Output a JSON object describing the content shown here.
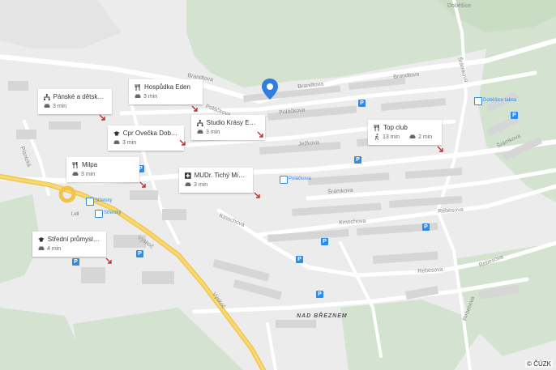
{
  "map": {
    "copyright": "© ČÚZK",
    "streets": [
      {
        "id": "brandtova-1",
        "text": "Brandtova"
      },
      {
        "id": "brandtova-2",
        "text": "Brandtova"
      },
      {
        "id": "brandtova-3",
        "text": "Brandtova"
      },
      {
        "id": "polackova-1",
        "text": "Poláčkova"
      },
      {
        "id": "polackova-2",
        "text": "Poláčkova"
      },
      {
        "id": "jezkova",
        "text": "Ježkova"
      },
      {
        "id": "sramkova-1",
        "text": "Šrámkova"
      },
      {
        "id": "sramkova-2",
        "text": "Šrámkova"
      },
      {
        "id": "sramkova-3",
        "text": "Šrámkova"
      },
      {
        "id": "kmochova-1",
        "text": "Kmochova"
      },
      {
        "id": "kmochova-2",
        "text": "Kmochova"
      },
      {
        "id": "rebesova-1",
        "text": "Rebesova"
      },
      {
        "id": "rebesova-2",
        "text": "Rebesova"
      },
      {
        "id": "rebesova-3",
        "text": "Rebesova"
      },
      {
        "id": "rebesova-4",
        "text": "Rebesova"
      },
      {
        "id": "vyskoc-1",
        "text": "Výskoč"
      },
      {
        "id": "vyskoc-2",
        "text": "Výskoč"
      },
      {
        "id": "pisnicka",
        "text": "Písnická"
      },
      {
        "id": "dobesice",
        "text": "Doběšice"
      },
      {
        "id": "nad-breznem",
        "text": "NAD BŘEZNEM"
      }
    ],
    "stops": [
      {
        "id": "strelsky-1",
        "text": "Střelský"
      },
      {
        "id": "strelsky-2",
        "text": "Střelský"
      },
      {
        "id": "polackova-stop",
        "text": "Poláčkova"
      },
      {
        "id": "dobesice-stop",
        "text": "Doběšice tabsa"
      },
      {
        "id": "lidl",
        "text": "Lidl"
      }
    ]
  },
  "pois": [
    {
      "id": "panske",
      "icon": "sitemap-icon",
      "name": "Pánské a dětské ...",
      "travel": [
        {
          "mode": "car",
          "time": "3 min"
        }
      ]
    },
    {
      "id": "hospudka",
      "icon": "restaurant-icon",
      "name": "Hospůdka Eden",
      "travel": [
        {
          "mode": "car",
          "time": "3 min"
        }
      ]
    },
    {
      "id": "cpr",
      "icon": "school-icon",
      "name": "Cpr Ovečka Době...",
      "travel": [
        {
          "mode": "car",
          "time": "3 min"
        }
      ]
    },
    {
      "id": "studio",
      "icon": "sitemap-icon",
      "name": "Studio Krásy Ede...",
      "travel": [
        {
          "mode": "car",
          "time": "3 min"
        }
      ]
    },
    {
      "id": "topclub",
      "icon": "restaurant-icon",
      "name": "Top club",
      "travel": [
        {
          "mode": "walk",
          "time": "13 min"
        },
        {
          "mode": "car",
          "time": "2 min"
        }
      ]
    },
    {
      "id": "milpa",
      "icon": "restaurant-icon",
      "name": "Milpa",
      "travel": [
        {
          "mode": "car",
          "time": "3 min"
        }
      ]
    },
    {
      "id": "mudr",
      "icon": "medical-icon",
      "name": "MUDr. Tichý Michal",
      "travel": [
        {
          "mode": "car",
          "time": "3 min"
        }
      ]
    },
    {
      "id": "stredni",
      "icon": "school-icon",
      "name": "Střední průmyslo...",
      "travel": [
        {
          "mode": "car",
          "time": "4 min"
        }
      ]
    }
  ]
}
